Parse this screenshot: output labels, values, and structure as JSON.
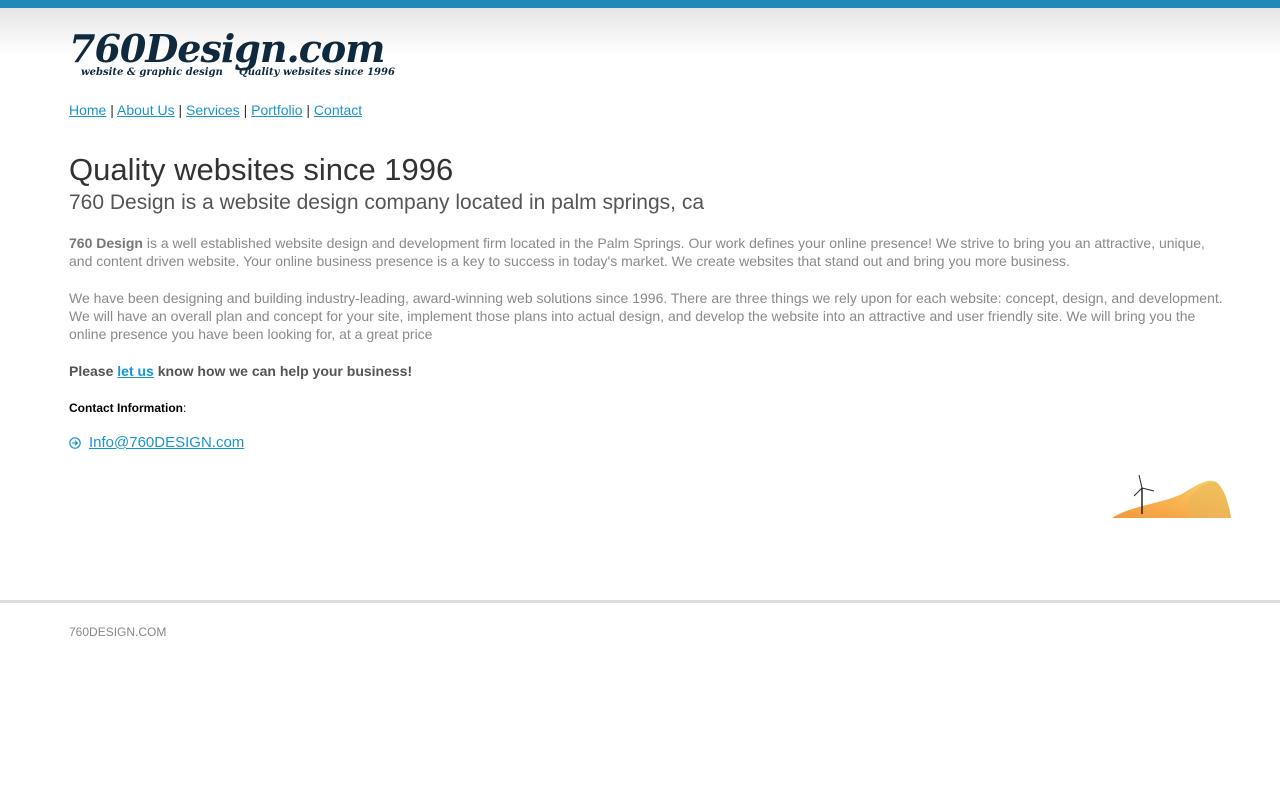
{
  "logo": {
    "main": "760Design.com",
    "tagline_left": "website & graphic design",
    "tagline_right": "Quality websites since 1996"
  },
  "nav": {
    "items": [
      {
        "label": "Home"
      },
      {
        "label": "About Us"
      },
      {
        "label": "Services"
      },
      {
        "label": "Portfolio"
      },
      {
        "label": "Contact"
      }
    ],
    "separator": "|"
  },
  "main": {
    "title": "Quality websites since 1996",
    "subtitle": "760 Design is a website design company located in palm springs, ca",
    "para1_lead": "760 Design",
    "para1_rest": " is a well established website design and development firm located in the Palm Springs. Our work defines your online presence! We strive to bring you an attractive, unique, and content driven website. Your online business presence is a key to success in today's market. We create websites that stand out and bring you more business.",
    "para2": "We have been designing and building industry-leading, award-winning web solutions since 1996. There are three things we rely upon for each website: concept, design, and development. We will have an overall plan and concept for your site, implement those plans into actual design, and develop the website into an attractive and user friendly site. We will bring you the online presence you have been looking for, at a great price",
    "cta_before": "Please ",
    "cta_link": "let us",
    "cta_after": " know how we can help your business!",
    "contact_label": "Contact Information",
    "contact_colon": ":",
    "email": "Info@760DESIGN.com"
  },
  "footer": {
    "text": "760DESIGN.COM"
  },
  "colors": {
    "top_bar": "#2189b8",
    "link": "#1a95cc",
    "logo": "#0f2a3f"
  },
  "icons": {
    "contact": "circle-arrow-right-icon",
    "decoration": "desert-windmill-icon"
  }
}
